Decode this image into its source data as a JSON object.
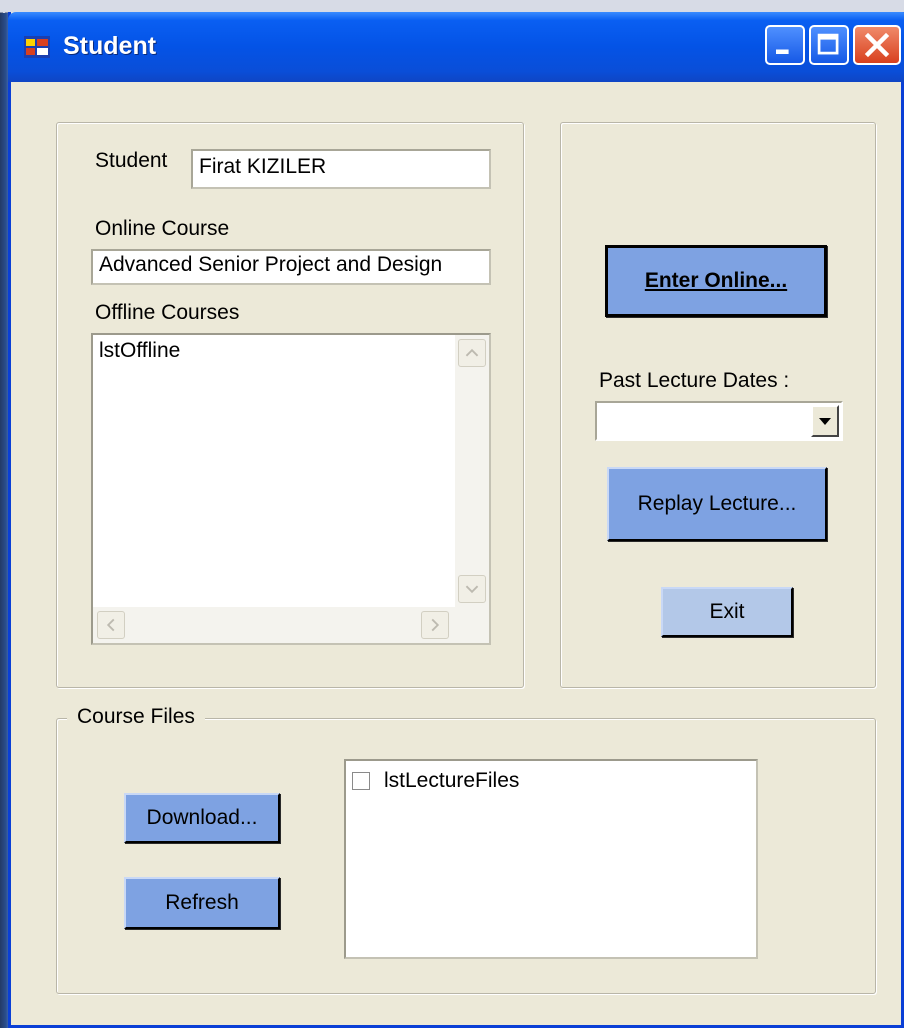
{
  "window": {
    "title": "Student"
  },
  "student_group": {
    "student_label": "Student",
    "student_value": "Firat KIZILER",
    "online_course_label": "Online Course",
    "online_course_value": "Advanced Senior Project and Design",
    "offline_courses_label": "Offline Courses",
    "offline_list_items": [
      "lstOffline"
    ]
  },
  "actions_group": {
    "enter_online_label": "Enter Online...",
    "past_lecture_dates_label": "Past Lecture Dates :",
    "past_lecture_dates_value": "",
    "replay_lecture_label": "Replay Lecture...",
    "exit_label": "Exit"
  },
  "course_files_group": {
    "legend": "Course Files",
    "download_label": "Download...",
    "refresh_label": "Refresh",
    "lecture_files_items": [
      {
        "label": "lstLectureFiles",
        "checked": false
      }
    ]
  },
  "colors": {
    "titlebar": "#0453e6",
    "window_bg": "#ece9d8",
    "button_bg": "#7ea2e2"
  },
  "icons": [
    "app-icon",
    "minimize-icon",
    "maximize-icon",
    "close-icon",
    "scroll-up-icon",
    "scroll-down-icon",
    "scroll-left-icon",
    "scroll-right-icon",
    "dropdown-arrow-icon"
  ]
}
